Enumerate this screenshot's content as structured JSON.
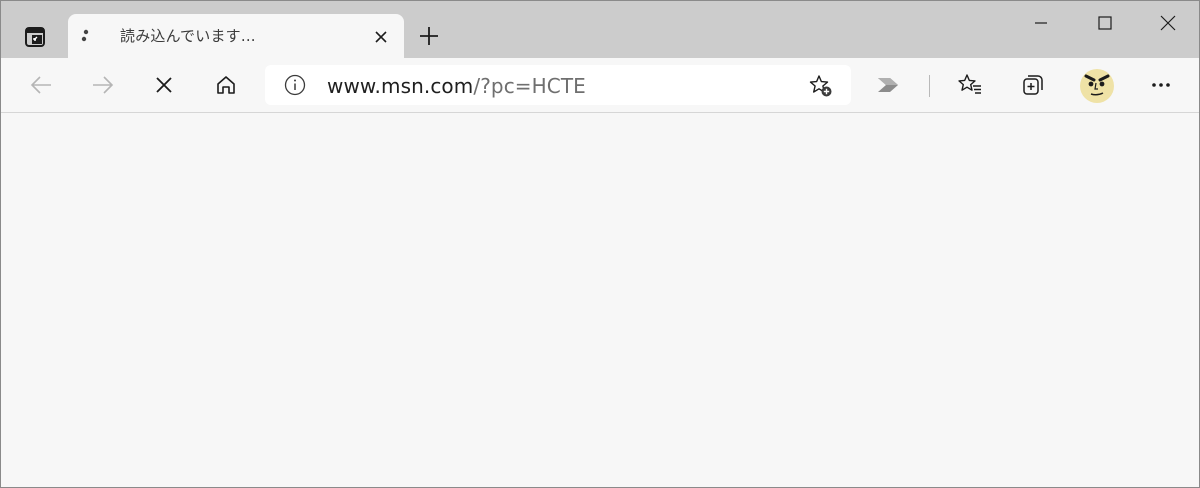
{
  "tab": {
    "title": "読み込んでいます...",
    "status": "loading"
  },
  "address_bar": {
    "url_host": "www.msn.com",
    "url_path": "/?pc=HCTE"
  },
  "icons": {
    "tab_actions": "tab-actions-icon",
    "loading": "loading-spinner-icon",
    "tab_close": "close-icon",
    "new_tab": "plus-icon",
    "minimize": "minimize-icon",
    "maximize": "maximize-icon",
    "window_close": "close-icon",
    "back": "arrow-left-icon",
    "forward": "arrow-right-icon",
    "stop": "stop-icon",
    "home": "home-icon",
    "site_info": "info-icon",
    "add_favorite": "star-add-icon",
    "extension": "chevron-extension-icon",
    "favorites": "favorites-list-icon",
    "collections": "collections-icon",
    "profile": "avatar",
    "more": "more-icon"
  },
  "colors": {
    "tab_strip": "#cccccc",
    "toolbar": "#f7f7f7",
    "address_bg": "#ffffff",
    "avatar_bg": "#efe2a6"
  }
}
